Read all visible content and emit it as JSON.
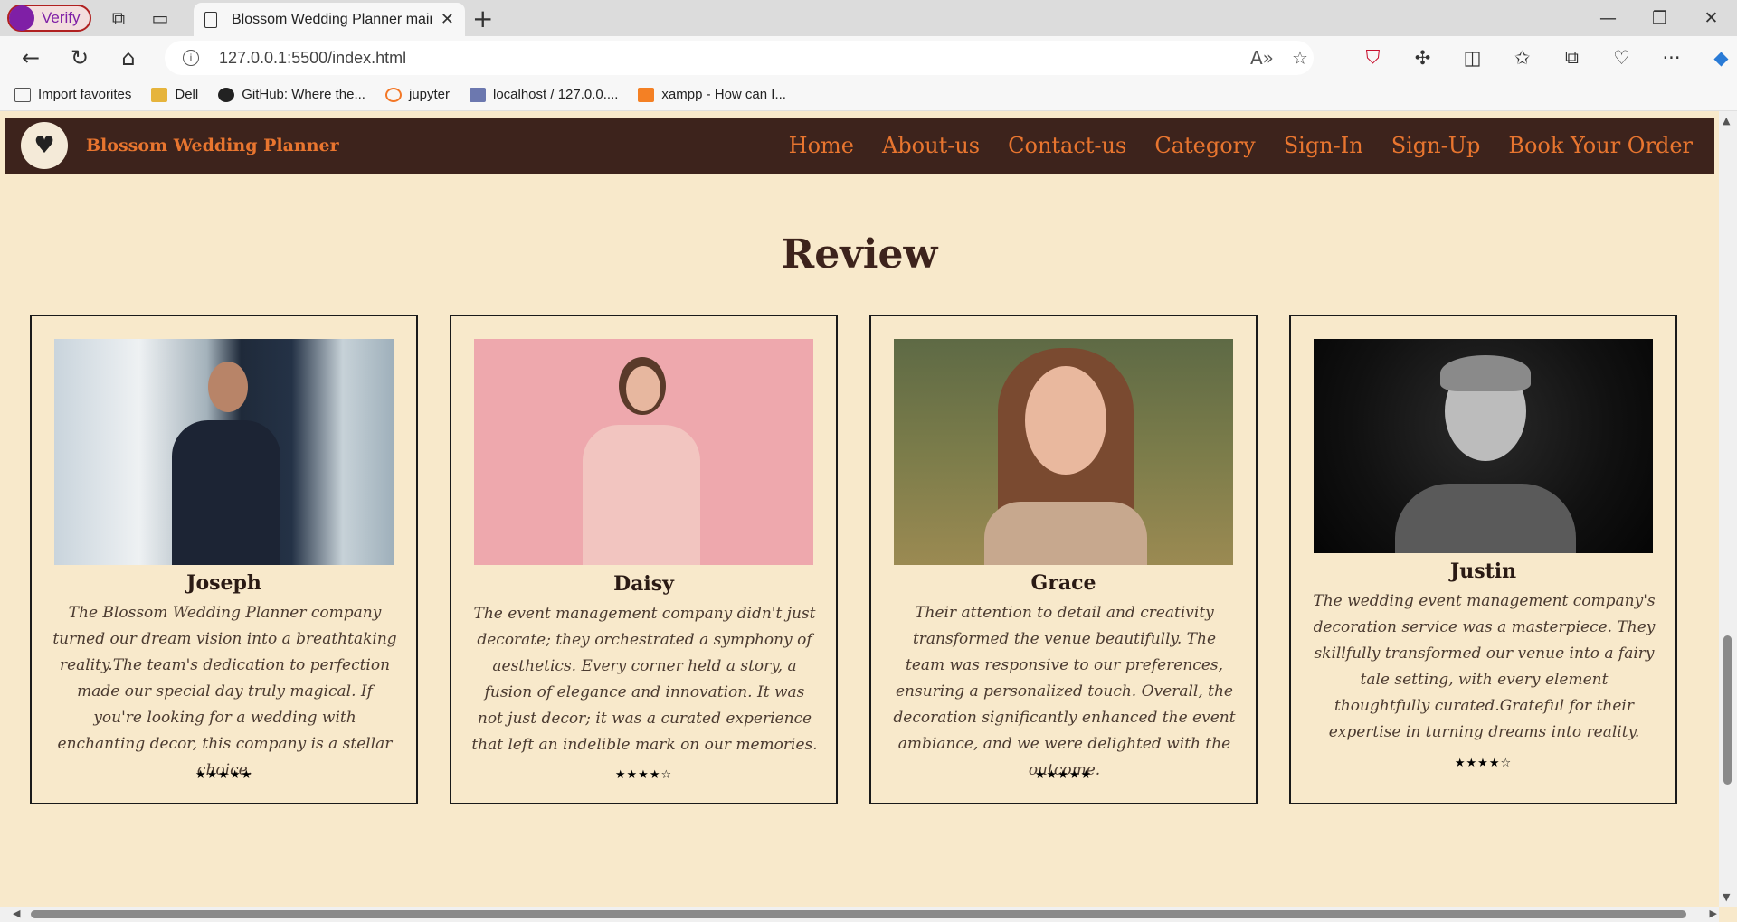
{
  "browser": {
    "verify_label": "Verify",
    "tab_title": "Blossom Wedding Planner main",
    "url": "127.0.0.1:5500/index.html",
    "favorites": [
      {
        "label": "Import favorites",
        "color": "#555555"
      },
      {
        "label": "Dell",
        "color": "#e6b43c"
      },
      {
        "label": "GitHub: Where the...",
        "color": "#222222"
      },
      {
        "label": "jupyter",
        "color": "#f37726"
      },
      {
        "label": "localhost / 127.0.0....",
        "color": "#6c78af"
      },
      {
        "label": "xampp - How can I...",
        "color": "#f48024"
      }
    ]
  },
  "site": {
    "brand": "Blossom Wedding Planner",
    "nav": [
      "Home",
      "About-us",
      "Contact-us",
      "Category",
      "Sign-In",
      "Sign-Up",
      "Book Your Order"
    ],
    "section_title": "Review"
  },
  "reviews": [
    {
      "name": "Joseph",
      "text": "The Blossom Wedding Planner company turned our dream vision into a breathtaking reality.The team's dedication to perfection made our special day truly magical. If you're looking for a wedding with enchanting decor, this company is a stellar choice.",
      "rating": 5,
      "stars": "★★★★★"
    },
    {
      "name": "Daisy",
      "text": "The event management company didn't just decorate; they orchestrated a symphony of aesthetics. Every corner held a story, a fusion of elegance and innovation. It was not just decor; it was a curated experience that left an indelible mark on our memories.",
      "rating": 4,
      "stars": "★★★★☆"
    },
    {
      "name": "Grace",
      "text": "Their attention to detail and creativity transformed the venue beautifully. The team was responsive to our preferences, ensuring a personalized touch. Overall, the decoration significantly enhanced the event ambiance, and we were delighted with the outcome.",
      "rating": 5,
      "stars": "★★★★★"
    },
    {
      "name": "Justin",
      "text": "The wedding event management company's decoration service was a masterpiece. They skillfully transformed our venue into a fairy tale setting, with every element thoughtfully curated.Grateful for their expertise in turning dreams into reality.",
      "rating": 4,
      "stars": "★★★★☆"
    }
  ],
  "colors": {
    "page_bg": "#f8e9cb",
    "nav_bg": "#3d231c",
    "nav_text": "#e8752f",
    "title": "#3d231c"
  }
}
